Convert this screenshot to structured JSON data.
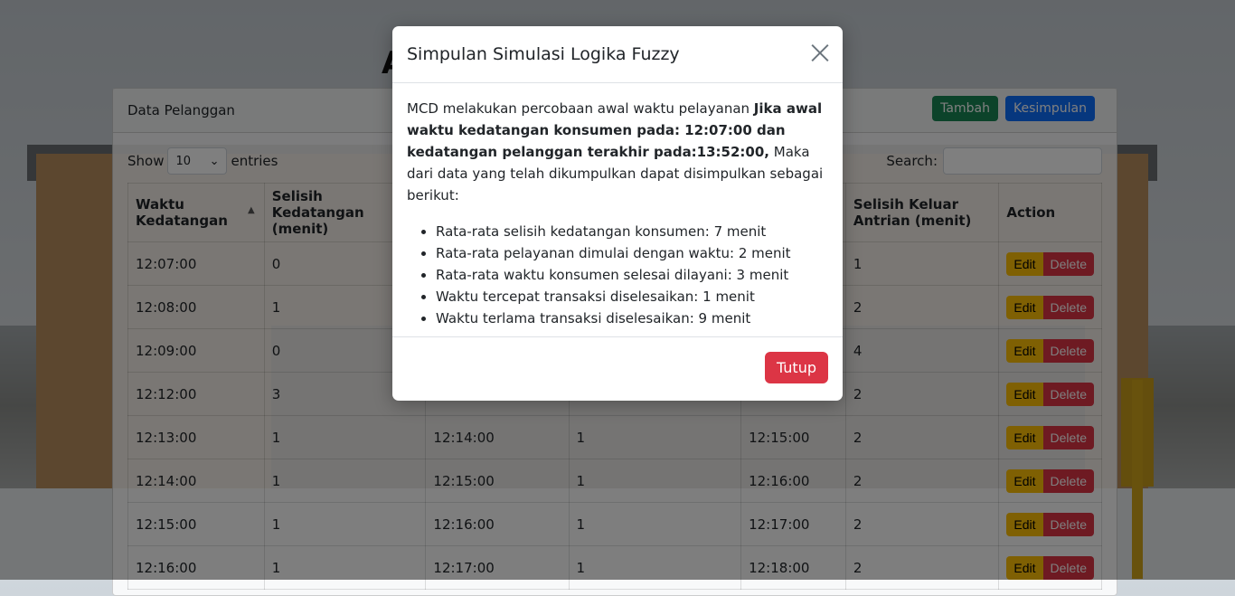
{
  "page": {
    "title_peek": "A"
  },
  "card": {
    "title": "Data Pelanggan",
    "btn_tambah": "Tambah",
    "btn_kesimpulan": "Kesimpulan",
    "show_label": "Show",
    "entries_value": "10",
    "entries_label": "entries",
    "search_label": "Search:"
  },
  "table": {
    "headers": [
      "Waktu Kedatangan",
      "Selisih Kedatangan (menit)",
      "",
      "",
      "",
      "Selisih Keluar Antrian (menit)",
      "Action"
    ],
    "rows": [
      [
        "12:07:00",
        "0",
        "",
        "",
        "",
        "1"
      ],
      [
        "12:08:00",
        "1",
        "",
        "",
        "",
        "2"
      ],
      [
        "12:09:00",
        "0",
        "",
        "",
        "",
        "4"
      ],
      [
        "12:12:00",
        "3",
        "",
        "",
        "",
        "2"
      ],
      [
        "12:13:00",
        "1",
        "12:14:00",
        "1",
        "12:15:00",
        "2"
      ],
      [
        "12:14:00",
        "1",
        "12:15:00",
        "1",
        "12:16:00",
        "2"
      ],
      [
        "12:15:00",
        "1",
        "12:16:00",
        "1",
        "12:17:00",
        "2"
      ],
      [
        "12:16:00",
        "1",
        "12:17:00",
        "1",
        "12:18:00",
        "2"
      ]
    ],
    "edit_label": "Edit",
    "delete_label": "Delete"
  },
  "modal": {
    "title": "Simpulan Simulasi Logika Fuzzy",
    "intro_text": "MCD melakukan percobaan awal waktu pelayanan ",
    "intro_bold": "Jika awal waktu kedatangan konsumen pada: 12:07:00 dan kedatangan pelanggan terakhir pada:13:52:00,",
    "intro_rest": " Maka dari data yang telah dikumpulkan dapat disimpulkan sebagai berikut:",
    "items": [
      "Rata-rata selisih kedatangan konsumen: 7 menit",
      "Rata-rata pelayanan dimulai dengan waktu: 2 menit",
      "Rata-rata waktu konsumen selesai dilayani: 3 menit",
      "Waktu tercepat transaksi diselesaikan: 1 menit",
      "Waktu terlama transaksi diselesaikan: 9 menit"
    ],
    "close_button": "Tutup"
  },
  "colors": {
    "success": "#198754",
    "primary": "#0d6efd",
    "warning": "#ffc107",
    "danger": "#dc3545"
  },
  "icons": {
    "close": "close-icon",
    "sort": "sort-icon",
    "chevron": "chevron-down-icon"
  }
}
